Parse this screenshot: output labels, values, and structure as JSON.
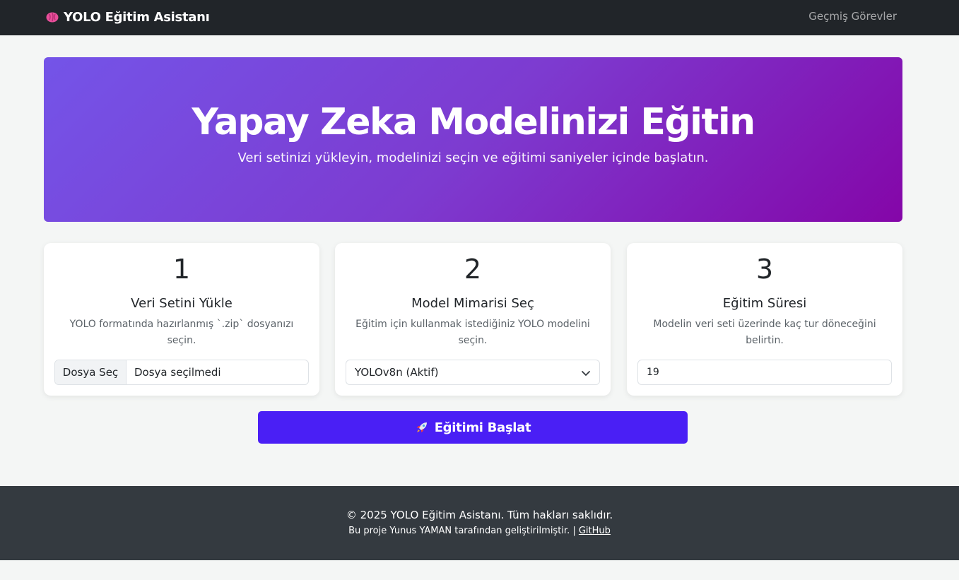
{
  "navbar": {
    "brand_icon": "brain-icon",
    "brand": "YOLO Eğitim Asistanı",
    "history_link": "Geçmiş Görevler"
  },
  "hero": {
    "title": "Yapay Zeka Modelinizi Eğitin",
    "subtitle": "Veri setinizi yükleyin, modelinizi seçin ve eğitimi saniyeler içinde başlatın.",
    "gradient_start": "#7454e8",
    "gradient_end": "#8406a8"
  },
  "steps": [
    {
      "number": "1",
      "title": "Veri Setini Yükle",
      "description": "YOLO formatında hazırlanmış `.zip` dosyanızı seçin.",
      "file_button": "Dosya Seç",
      "file_status": "Dosya seçilmedi"
    },
    {
      "number": "2",
      "title": "Model Mimarisi Seç",
      "description": "Eğitim için kullanmak istediğiniz YOLO modelini seçin.",
      "selected_model": "YOLOv8n (Aktif)"
    },
    {
      "number": "3",
      "title": "Eğitim Süresi",
      "description": "Modelin veri seti üzerinde kaç tur döneceğini belirtin.",
      "epochs_value": "19"
    }
  ],
  "start_button": {
    "icon": "rocket-icon",
    "label": "Eğitimi Başlat",
    "color": "#4a1ff5"
  },
  "footer": {
    "copyright": "© 2025 YOLO Eğitim Asistanı. Tüm hakları saklıdır.",
    "credit_prefix": "Bu proje Yunus YAMAN tarafından geliştirilmiştir. |",
    "github_link": "GitHub"
  }
}
